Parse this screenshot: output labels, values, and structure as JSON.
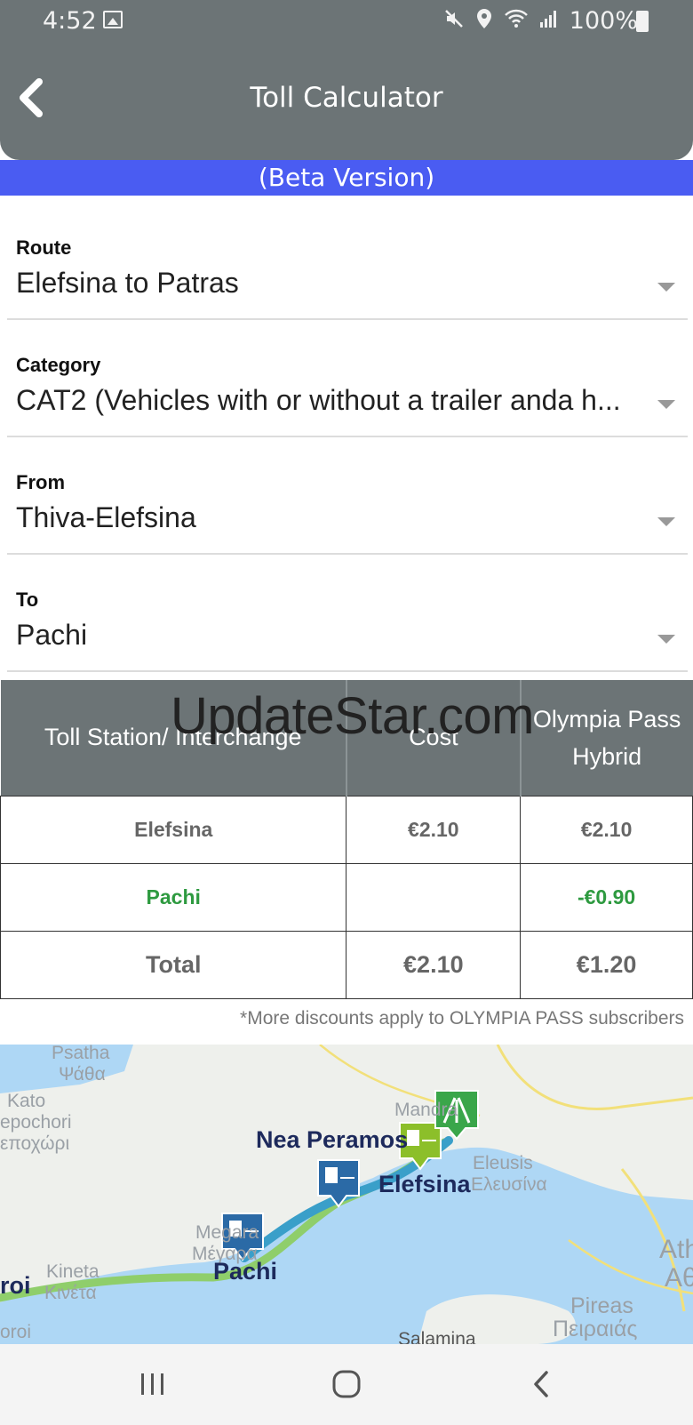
{
  "status_bar": {
    "time": "4:52",
    "battery_percent": "100%"
  },
  "header": {
    "title": "Toll Calculator"
  },
  "beta_banner": "(Beta Version)",
  "form": {
    "route": {
      "label": "Route",
      "value": "Elefsina to Patras"
    },
    "category": {
      "label": "Category",
      "value": "CAT2 (Vehicles with or without a trailer anda h..."
    },
    "from": {
      "label": "From",
      "value": "Thiva-Elefsina"
    },
    "to": {
      "label": "To",
      "value": "Pachi"
    }
  },
  "table": {
    "headers": [
      "Toll Station/ Interchange",
      "Cost",
      "Olympia Pass Hybrid"
    ],
    "rows": [
      {
        "station": "Elefsina",
        "cost": "€2.10",
        "olympia": "€2.10"
      },
      {
        "station": "Pachi",
        "cost": "",
        "olympia": "-€0.90"
      },
      {
        "station": "Total",
        "cost": "€2.10",
        "olympia": "€1.20"
      }
    ]
  },
  "watermark": "UpdateStar.com",
  "note": "*More discounts apply to OLYMPIA PASS subscribers",
  "map": {
    "labels": [
      "Psatha",
      "Ψάθα",
      "Kato",
      "epochori",
      "εποχώρι",
      "Mandra",
      "Eleusis",
      "Ελευσίνα",
      "Megara",
      "Μέγαρα",
      "Kineta",
      "Κινέτα",
      "Ath",
      "Αθ",
      "Pireas",
      "Πειραιάς",
      "Salamina",
      "roi",
      "oroi"
    ],
    "cities": [
      "Nea Peramos",
      "Elefsina",
      "Pachi"
    ]
  },
  "colors": {
    "header": "#6c7476",
    "beta": "#4a5cf2",
    "green": "#2e9a40"
  }
}
